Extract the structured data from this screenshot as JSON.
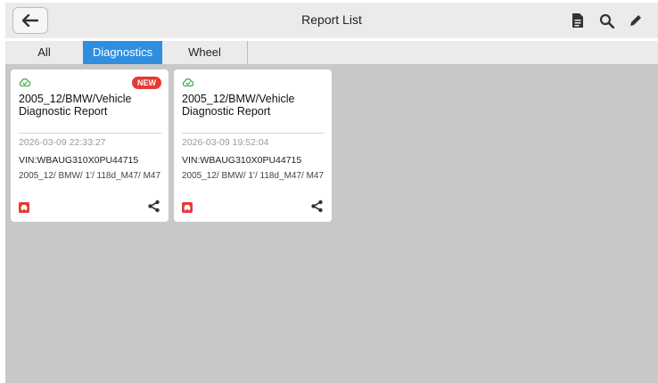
{
  "header": {
    "title": "Report List",
    "icons": [
      "back-arrow-icon",
      "report-doc-icon",
      "search-icon",
      "edit-pencil-icon"
    ]
  },
  "tabs": [
    {
      "label": "All",
      "active": false
    },
    {
      "label": "Diagnostics",
      "active": true
    },
    {
      "label": "Wheel Alignment",
      "active": false
    }
  ],
  "reports": [
    {
      "badge": "NEW",
      "title": "2005_12/BMW/Vehicle Diagnostic Report",
      "date": "2026-03-09 22:33:27",
      "vin": "VIN:WBAUG310X0PU44715",
      "model": "2005_12/ BMW/ 1'/ 118d_M47/ M47"
    },
    {
      "badge": "",
      "title": "2005_12/BMW/Vehicle Diagnostic Report",
      "date": "2026-03-09 19:52:04",
      "vin": "VIN:WBAUG310X0PU44715",
      "model": "2005_12/ BMW/ 1'/ 118d_M47/ M47"
    }
  ],
  "colors": {
    "accent": "#2f8ee0",
    "badge": "#e53935",
    "cloud": "#4caf50",
    "content_bg": "#c8c8c8",
    "bar_bg": "#ebebeb"
  }
}
